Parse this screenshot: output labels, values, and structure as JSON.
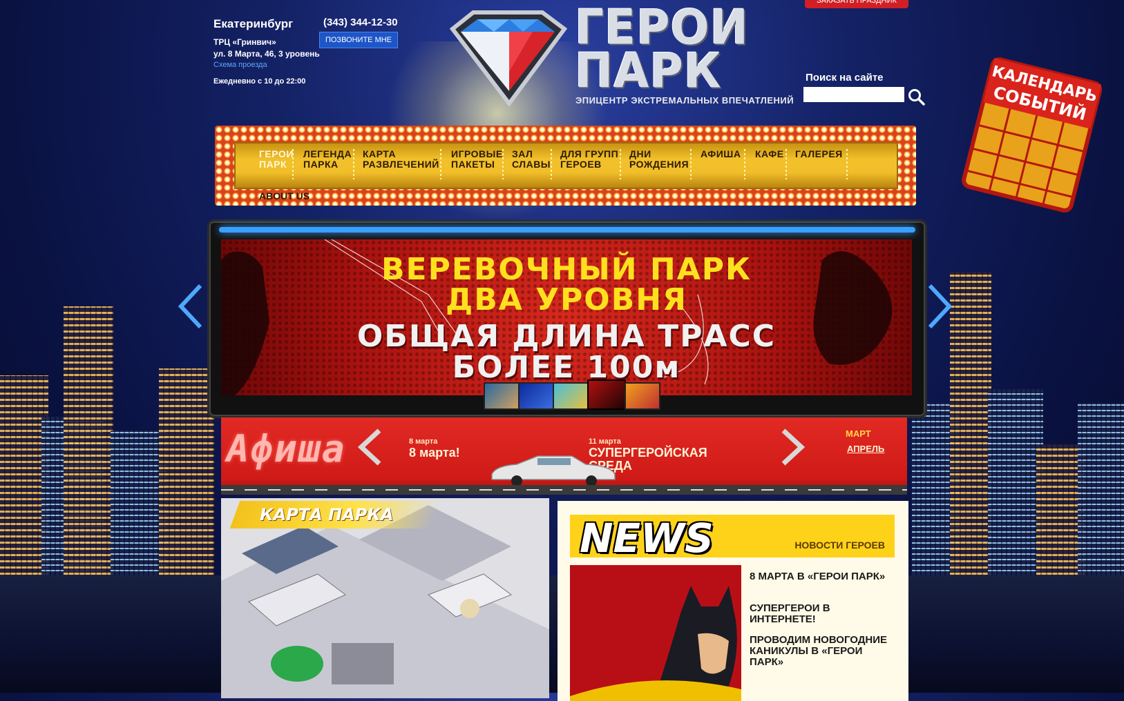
{
  "header": {
    "city": "Екатеринбург",
    "phone": "(343) 344-12-30",
    "call_button": "ПОЗВОНИТЕ МНЕ",
    "mall": "ТРЦ «Гринвич»",
    "address": "ул. 8 Марта, 46, 3 уровень",
    "route_link": "Схема проезда",
    "hours": "Ежедневно с 10 до 22:00",
    "order_button": "ЗАКАЗАТЬ ПРАЗДНИК"
  },
  "logo": {
    "line1": "ГЕРОИ",
    "line2": "ПАРК",
    "tagline": "ЭПИЦЕНТР ЭКСТРЕМАЛЬНЫХ ВПЕЧАТЛЕНИЙ"
  },
  "search": {
    "label": "Поиск на сайте",
    "value": ""
  },
  "calendar": {
    "line1": "КАЛЕНДАРЬ",
    "line2": "СОБЫТИЙ"
  },
  "nav": {
    "items": [
      {
        "l1": "ГЕРОИ",
        "l2": "ПАРК"
      },
      {
        "l1": "ЛЕГЕНДА",
        "l2": "ПАРКА"
      },
      {
        "l1": "КАРТА",
        "l2": "РАЗВЛЕЧЕНИЙ"
      },
      {
        "l1": "ИГРОВЫЕ",
        "l2": "ПАКЕТЫ"
      },
      {
        "l1": "ЗАЛ",
        "l2": "СЛАВЫ"
      },
      {
        "l1": "ДЛЯ ГРУПП",
        "l2": "ГЕРОЕВ"
      },
      {
        "l1": "ДНИ",
        "l2": "РОЖДЕНИЯ"
      },
      {
        "l1": "АФИША",
        "l2": ""
      },
      {
        "l1": "КАФЕ",
        "l2": ""
      },
      {
        "l1": "ГАЛЕРЕЯ",
        "l2": ""
      }
    ],
    "about": "ABOUT US"
  },
  "slider": {
    "line1": "ВЕРЕВОЧНЫЙ ПАРК",
    "line2": "ДВА УРОВНЯ",
    "line3": "ОБЩАЯ ДЛИНА ТРАСС",
    "line4": "БОЛЕЕ 100м"
  },
  "afisha": {
    "title": "Афиша",
    "events": [
      {
        "date": "8 марта",
        "title": "8 марта!"
      },
      {
        "date": "11 марта",
        "title": "СУПЕРГЕРОЙСКАЯ СРЕДА"
      }
    ],
    "months": [
      "МАРТ",
      "АПРЕЛЬ"
    ]
  },
  "map": {
    "title": "КАРТА ПАРКА"
  },
  "news": {
    "logo": "NEWS",
    "subtitle": "НОВОСТИ ГЕРОЕВ",
    "items": [
      "8 МАРТА В «ГЕРОИ ПАРК»",
      "СУПЕРГЕРОИ В ИНТЕРНЕТЕ!",
      "ПРОВОДИМ НОВОГОДНИЕ КАНИКУЛЫ В «ГЕРОИ ПАРК»"
    ]
  },
  "colors": {
    "accent_yellow": "#ffe01e",
    "nav_gold": "#f2c02a",
    "afisha_red": "#d21f25",
    "link_blue": "#5aa7ff"
  }
}
